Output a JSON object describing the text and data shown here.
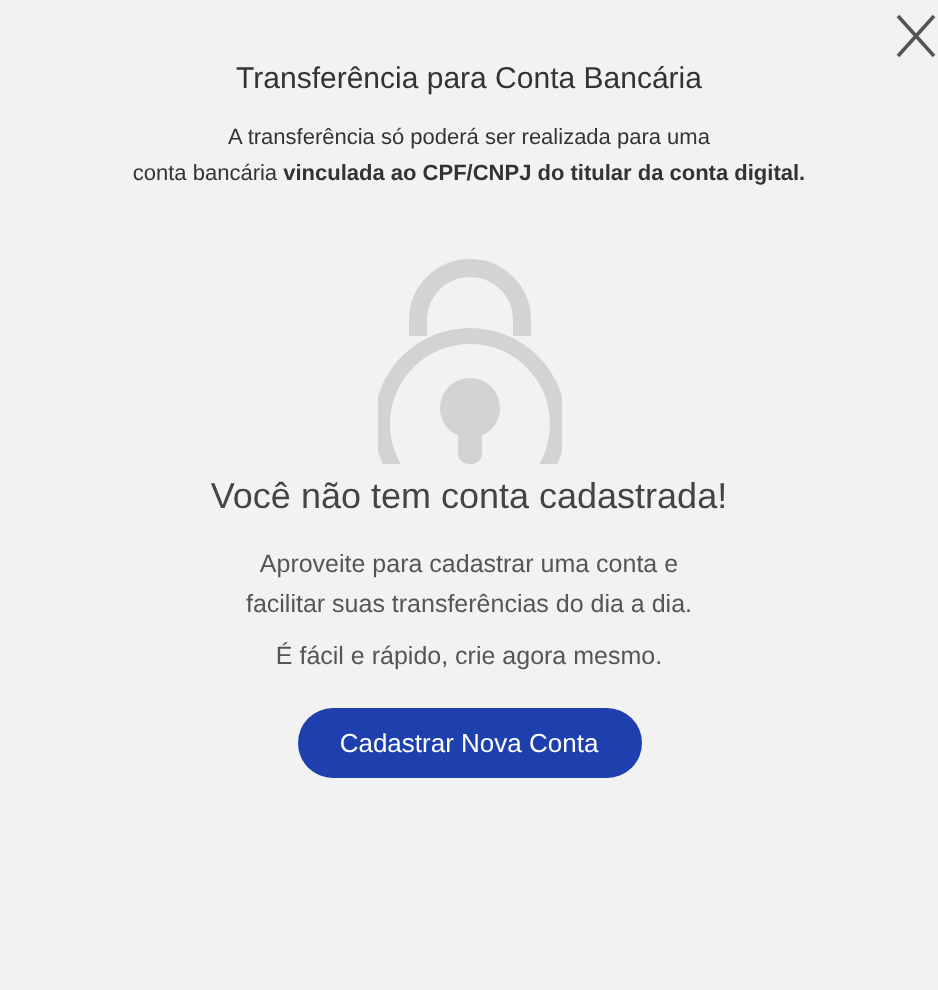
{
  "title": "Transferência para Conta Bancária",
  "subtitle_lines": [
    "A transferência só poderá ser realizada para uma",
    "conta bancária **vinculada ao CPF/CNPJ do titular da conta digital.**"
  ],
  "heading": "Você não tem conta cadastrada!",
  "body_lines": [
    "Aproveite para cadastrar uma conta e",
    "facilitar suas transferências do dia a dia."
  ],
  "note": "É fácil e rápido, crie agora mesmo.",
  "button": "Cadastrar Nova Conta"
}
